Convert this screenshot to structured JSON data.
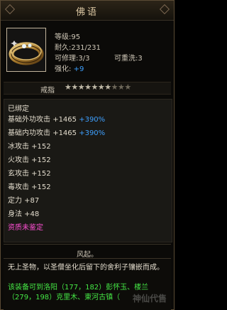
{
  "title": "佛语",
  "item": {
    "level": "等级:95",
    "durability": "耐久:231/231",
    "repairable": "可修理:3/3",
    "rewashable": "可重洗:3",
    "enhance_label": "强化:",
    "enhance_value": "+9"
  },
  "type_label": "戒指",
  "stars": {
    "filled": 7,
    "total": 10
  },
  "stats": {
    "bound": "已绑定",
    "ext_atk_label": "基础外功攻击",
    "ext_atk_value": "+1465",
    "ext_atk_pct": "+390%",
    "int_atk_label": "基础内功攻击",
    "int_atk_value": "+1465",
    "int_atk_pct": "+390%",
    "ice": "冰攻击 +152",
    "fire": "火攻击 +152",
    "mystic": "玄攻击 +152",
    "poison": "毒攻击 +152",
    "focus": "定力 +87",
    "agility": "身法 +48",
    "aptitude": "资质未鉴定"
  },
  "quote": "风起。",
  "description": "无上圣物，以圣僧坐化后留下的舍利子镶嵌而成。",
  "location": "该装备可到洛阳（177，182）彭怀玉、楼兰（279，198）克里木、東河古镇（",
  "watermark": "神仙代售",
  "colors": {
    "accent_blue": "#3ea0ff",
    "pink": "#ff4fd3",
    "green": "#45e845",
    "gold_border": "#c2b49c"
  },
  "icons": [
    "diamond-ring-icon",
    "star-icon"
  ]
}
